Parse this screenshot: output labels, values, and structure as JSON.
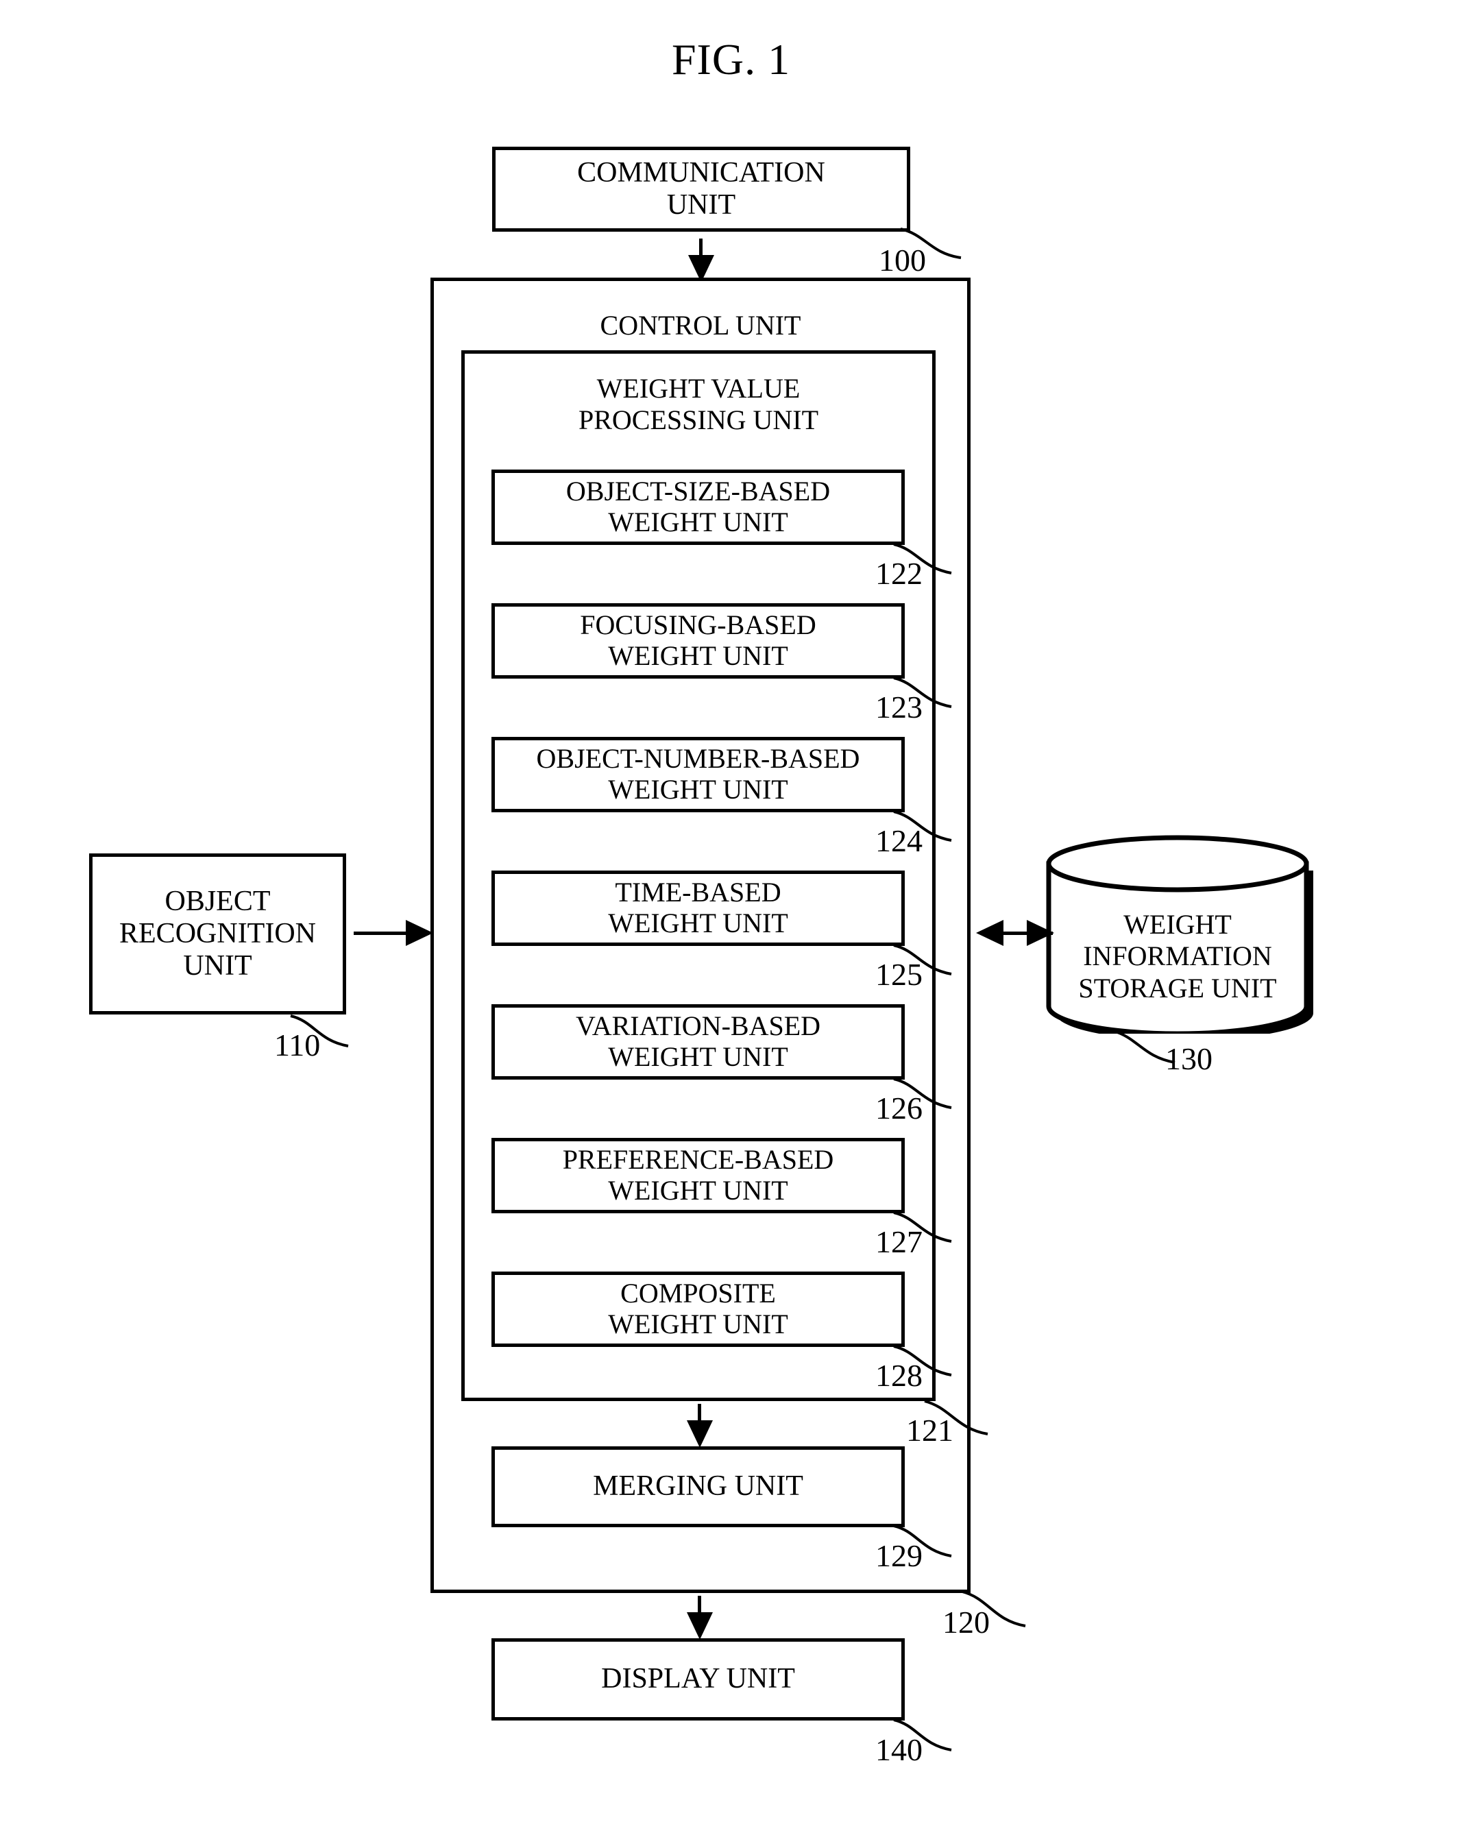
{
  "figure": {
    "title": "FIG. 1"
  },
  "nodes": {
    "communication_unit": {
      "label": "COMMUNICATION\nUNIT",
      "ref": "100"
    },
    "control_unit": {
      "label": "CONTROL UNIT",
      "ref": "120"
    },
    "weight_value_processing_unit": {
      "label": "WEIGHT VALUE\nPROCESSING UNIT",
      "ref": "121"
    },
    "object_recognition_unit": {
      "label": "OBJECT\nRECOGNITION\nUNIT",
      "ref": "110"
    },
    "weight_information_storage_unit": {
      "label": "WEIGHT\nINFORMATION\nSTORAGE UNIT",
      "ref": "130"
    },
    "merging_unit": {
      "label": "MERGING UNIT",
      "ref": "129"
    },
    "display_unit": {
      "label": "DISPLAY UNIT",
      "ref": "140"
    }
  },
  "weight_units": [
    {
      "label": "OBJECT-SIZE-BASED\nWEIGHT UNIT",
      "ref": "122"
    },
    {
      "label": "FOCUSING-BASED\nWEIGHT UNIT",
      "ref": "123"
    },
    {
      "label": "OBJECT-NUMBER-BASED\nWEIGHT UNIT",
      "ref": "124"
    },
    {
      "label": "TIME-BASED\nWEIGHT UNIT",
      "ref": "125"
    },
    {
      "label": "VARIATION-BASED\nWEIGHT UNIT",
      "ref": "126"
    },
    {
      "label": "PREFERENCE-BASED\nWEIGHT UNIT",
      "ref": "127"
    },
    {
      "label": "COMPOSITE\nWEIGHT UNIT",
      "ref": "128"
    }
  ],
  "colors": {
    "stroke": "#000000",
    "fill": "#ffffff",
    "text": "#000000"
  }
}
